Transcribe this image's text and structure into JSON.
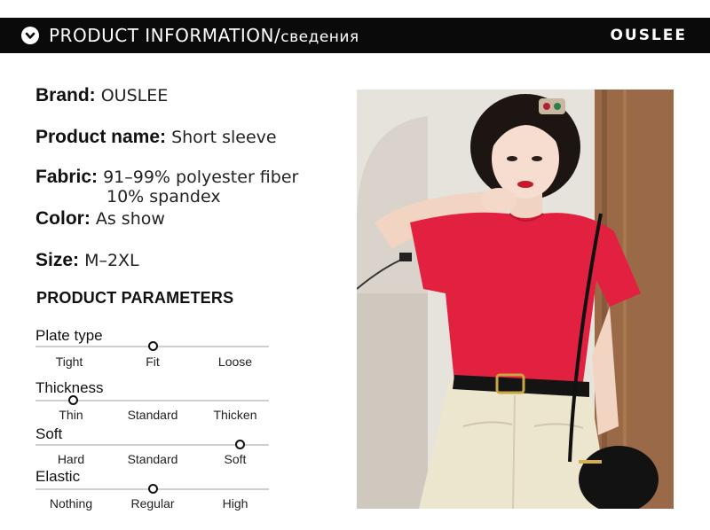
{
  "header": {
    "title": "PRODUCT INFORMATION/",
    "title_sub": "сведения",
    "brand_logo": "OUSLEE",
    "icon": "chevron-down-circle-icon"
  },
  "info": {
    "brand": {
      "key": "Brand:",
      "value": "OUSLEE"
    },
    "product_name": {
      "key": "Product name:",
      "value": "Short sleeve"
    },
    "fabric": {
      "key": "Fabric:",
      "value": "91–99% polyester fiber",
      "value2": "10% spandex"
    },
    "color": {
      "key": "Color:",
      "value": "As show"
    },
    "size": {
      "key": "Size:",
      "value": "M–2XL"
    }
  },
  "params_title": "PRODUCT PARAMETERS",
  "params": [
    {
      "label": "Plate type",
      "options": [
        "Tight",
        "Fit",
        "Loose"
      ],
      "selected": "Fit"
    },
    {
      "label": "Thickness",
      "options": [
        "Thin",
        "Standard",
        "Thicken"
      ],
      "selected": "Thin"
    },
    {
      "label": "Soft",
      "options": [
        "Hard",
        "Standard",
        "Soft"
      ],
      "selected": "Soft"
    },
    {
      "label": "Elastic",
      "options": [
        "Nothing",
        "Regular",
        "High"
      ],
      "selected": "Regular"
    }
  ],
  "colors": {
    "header_bg": "#0a0a0a",
    "shirt": "#e2203f",
    "skirt": "#ece6cf"
  }
}
